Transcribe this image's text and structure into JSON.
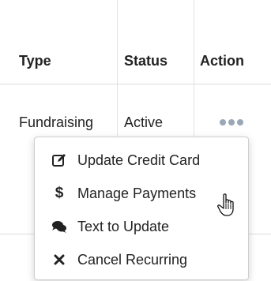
{
  "table": {
    "headers": {
      "type": "Type",
      "status": "Status",
      "action": "Action"
    },
    "row": {
      "type": "Fundraising",
      "status": "Active"
    }
  },
  "menu": {
    "items": [
      {
        "label": "Update Credit Card",
        "icon": "edit-icon"
      },
      {
        "label": "Manage Payments",
        "icon": "dollar-icon"
      },
      {
        "label": "Text to Update",
        "icon": "comments-icon"
      },
      {
        "label": "Cancel Recurring",
        "icon": "close-icon"
      }
    ]
  },
  "colors": {
    "dots": "#9aa7b6",
    "text": "#222222",
    "menu_border": "#cfcfcf"
  }
}
